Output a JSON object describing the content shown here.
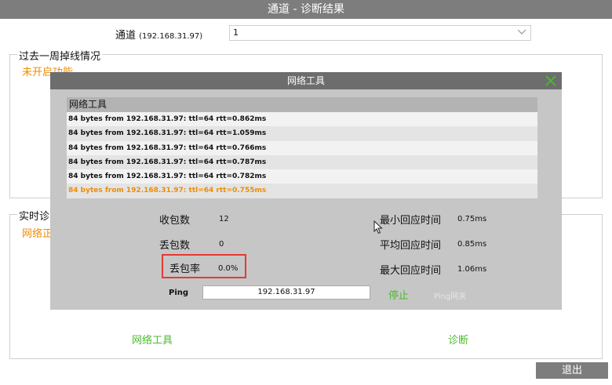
{
  "window": {
    "title": "通道 - 诊断结果"
  },
  "channel": {
    "label": "通道",
    "ip": "(192.168.31.97)",
    "value": "1"
  },
  "week_section": {
    "legend": "过去一周掉线情况",
    "status": "未开启功能"
  },
  "realtime_section": {
    "legend": "实时诊",
    "status": "网络正"
  },
  "bottom": {
    "network_tool_link": "网络工具",
    "diagnose_link": "诊断",
    "exit_label": "退出"
  },
  "dialog": {
    "title": "网络工具",
    "log_header": "网络工具",
    "log_lines": [
      "84 bytes from 192.168.31.97: ttl=64 rtt=0.862ms",
      "84 bytes from 192.168.31.97: ttl=64 rtt=1.059ms",
      "84 bytes from 192.168.31.97: ttl=64 rtt=0.766ms",
      "84 bytes from 192.168.31.97: ttl=64 rtt=0.787ms",
      "84 bytes from 192.168.31.97: ttl=64 rtt=0.782ms",
      "84 bytes from 192.168.31.97: ttl=64 rtt=0.755ms"
    ],
    "stats": {
      "received_label": "收包数",
      "received": "12",
      "lost_label": "丢包数",
      "lost": "0",
      "loss_rate_label": "丢包率",
      "loss_rate": "0.0%",
      "min_rtt_label": "最小回应时间",
      "min_rtt": "0.75ms",
      "avg_rtt_label": "平均回应时间",
      "avg_rtt": "0.85ms",
      "max_rtt_label": "最大回应时间",
      "max_rtt": "1.06ms"
    },
    "ping_label": "Ping",
    "ping_target": "192.168.31.97",
    "stop_label": "停止",
    "ping_gateway_label": "Ping网关"
  },
  "colors": {
    "accent_green": "#4cba2f",
    "accent_orange": "#f08c00",
    "highlight_red": "#e53935",
    "title_gray": "#7d7d7d"
  },
  "icons": {
    "dropdown": "chevron-down-icon",
    "close": "close-icon",
    "cursor": "mouse-pointer-icon"
  }
}
